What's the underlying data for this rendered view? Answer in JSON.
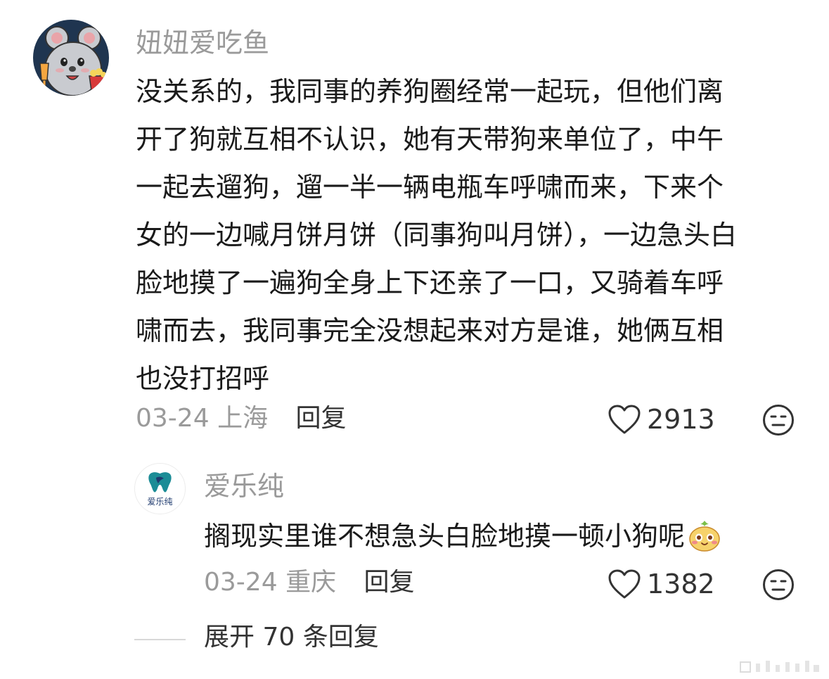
{
  "main_comment": {
    "username": "妞妞爱吃鱼",
    "avatar_icon": "mouse-cartoon-avatar-icon",
    "text_lines": [
      "没关系的，我同事的养狗圈经常一起玩，但他们离",
      "开了狗就互相不认识，她有天带狗来单位了，中午",
      "一起去遛狗，遛一半一辆电瓶车呼啸而来，下来个",
      "女的一边喊月饼月饼（同事狗叫月饼），一边急头白",
      "脸地摸了一遍狗全身上下还亲了一口，又骑着车呼",
      "啸而去，我同事完全没想起来对方是谁，她俩互相",
      "也没打招呼"
    ],
    "date": "03-24",
    "location": "上海",
    "reply_label": "回复",
    "like_count": "2913",
    "like_icon": "heart-icon",
    "dislike_icon": "meh-face-icon"
  },
  "reply_comment": {
    "username": "爱乐纯",
    "avatar_text": "爱乐纯",
    "avatar_icon": "tooth-logo-icon",
    "text": "搁现实里谁不想急头白脸地摸一顿小狗呢",
    "emoji_icon": "blushing-face-emoji-icon",
    "date": "03-24",
    "location": "重庆",
    "reply_label": "回复",
    "like_count": "1382",
    "like_icon": "heart-icon",
    "dislike_icon": "meh-face-icon"
  },
  "expand": {
    "label": "展开 70 条回复"
  },
  "colors": {
    "username": "#9a9a9a",
    "text": "#1a1a1a",
    "meta": "#9a9a9a",
    "action": "#333333",
    "brand_teal": "#1b8c96",
    "brand_navy": "#1e3a6e"
  }
}
